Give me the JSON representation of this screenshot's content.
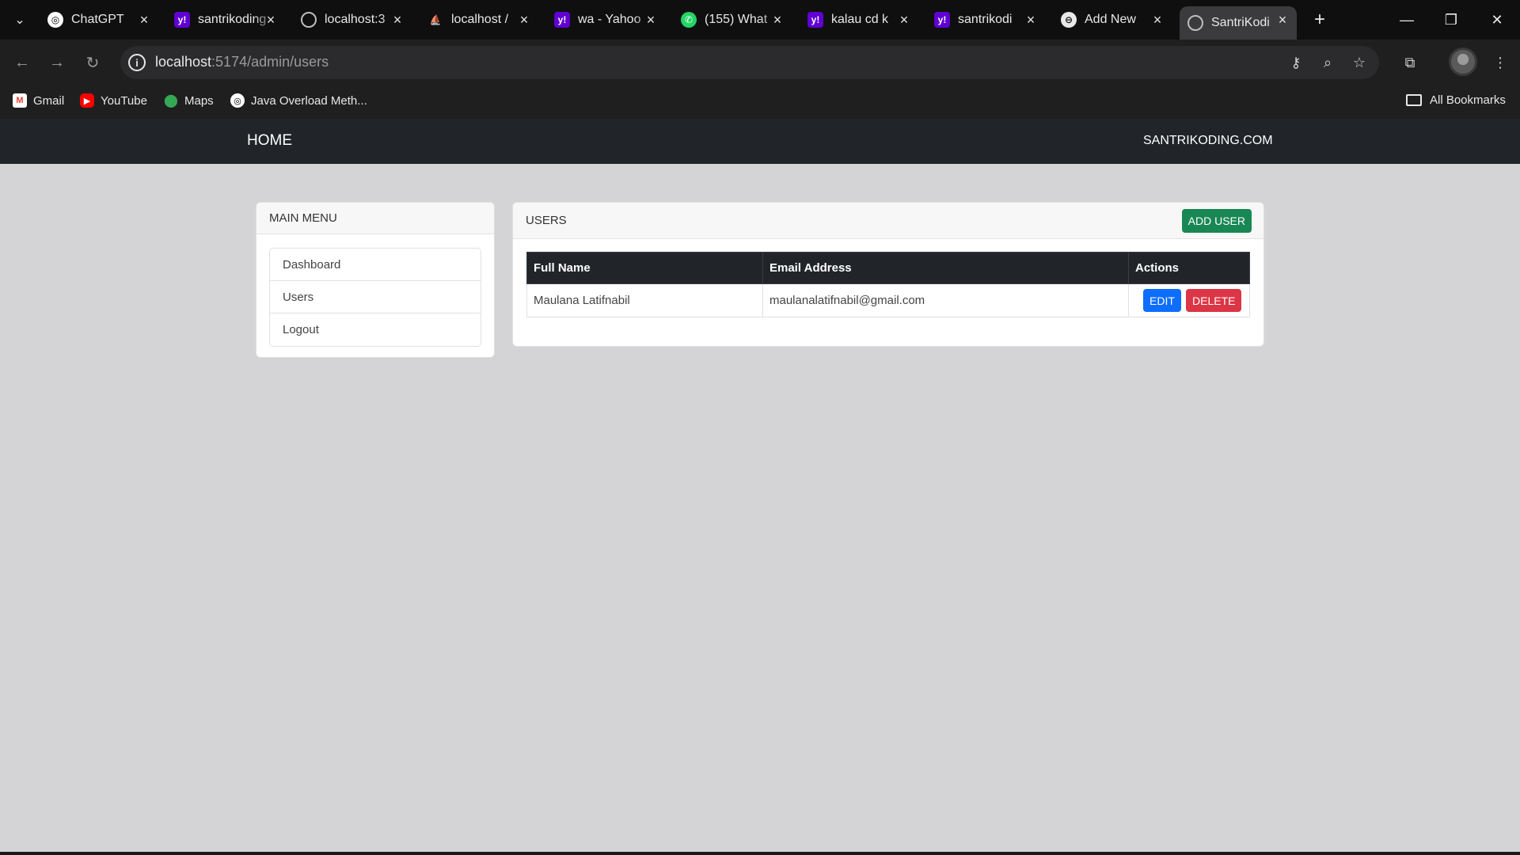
{
  "browser": {
    "tabs": [
      {
        "label": "ChatGPT",
        "icon": "chatgpt-icon"
      },
      {
        "label": "santrikoding",
        "icon": "yahoo-icon"
      },
      {
        "label": "localhost:3",
        "icon": "globe-icon"
      },
      {
        "label": "localhost / ",
        "icon": "phpmyadmin-icon"
      },
      {
        "label": "wa - Yahoo",
        "icon": "yahoo-icon"
      },
      {
        "label": "(155) What",
        "icon": "whatsapp-icon"
      },
      {
        "label": "kalau cd k",
        "icon": "yahoo-icon"
      },
      {
        "label": "santrikodi",
        "icon": "yahoo-icon"
      },
      {
        "label": "Add New",
        "icon": "add-new-icon"
      },
      {
        "label": "SantriKodi",
        "icon": "globe-icon",
        "active": true
      }
    ],
    "url_host": "localhost",
    "url_path": ":5174/admin/users",
    "bookmarks": [
      {
        "label": "Gmail",
        "icon": "gmail-icon"
      },
      {
        "label": "YouTube",
        "icon": "youtube-icon"
      },
      {
        "label": "Maps",
        "icon": "maps-icon"
      },
      {
        "label": "Java Overload Meth...",
        "icon": "chatgpt-icon"
      }
    ],
    "all_bookmarks": "All Bookmarks"
  },
  "navbar": {
    "home": "HOME",
    "brand": "SANTRIKODING.COM"
  },
  "menu": {
    "title": "MAIN MENU",
    "items": [
      "Dashboard",
      "Users",
      "Logout"
    ]
  },
  "users": {
    "title": "USERS",
    "add_label": "ADD USER",
    "columns": [
      "Full Name",
      "Email Address",
      "Actions"
    ],
    "rows": [
      {
        "name": "Maulana Latifnabil",
        "email": "maulanalatifnabil@gmail.com",
        "edit": "EDIT",
        "delete": "DELETE"
      }
    ]
  },
  "colors": {
    "navbar": "#212529",
    "add": "#198754",
    "edit": "#0d6efd",
    "delete": "#dc3545",
    "page_bg": "#d4d4d7"
  }
}
